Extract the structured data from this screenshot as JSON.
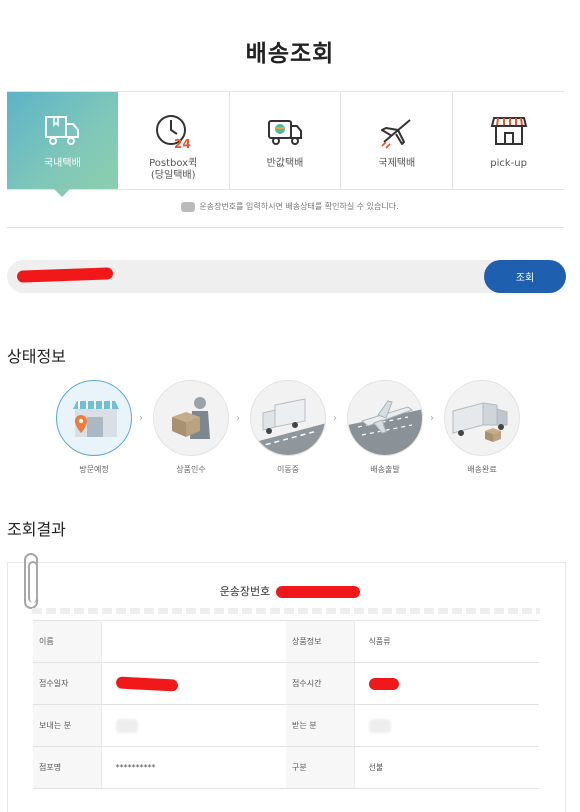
{
  "page_title": "배송조회",
  "tabs": [
    {
      "label": "국내택배",
      "icon": "truck-box-icon",
      "active": true
    },
    {
      "label": "Postbox퀵\n(당일택배)",
      "icon": "clock-24-icon",
      "active": false
    },
    {
      "label": "반값택배",
      "icon": "delivery-van-icon",
      "active": false
    },
    {
      "label": "국제택배",
      "icon": "airplane-icon",
      "active": false
    },
    {
      "label": "pick-up",
      "icon": "store-icon",
      "active": false
    }
  ],
  "notice": "운송장번호를 입력하시면 배송상태를 확인하실 수 있습니다.",
  "search": {
    "placeholder": "",
    "button_label": "조회"
  },
  "status_section_title": "상태정보",
  "steps": [
    {
      "label": "방문예정",
      "icon": "store-location-icon",
      "active": true
    },
    {
      "label": "상품인수",
      "icon": "courier-box-icon",
      "active": false
    },
    {
      "label": "이동중",
      "icon": "truck-road-icon",
      "active": false
    },
    {
      "label": "배송출발",
      "icon": "airport-plane-icon",
      "active": false
    },
    {
      "label": "배송완료",
      "icon": "delivered-truck-icon",
      "active": false
    }
  ],
  "result_section_title": "조회결과",
  "result": {
    "waybill_label": "운송장번호",
    "rows": [
      {
        "k1": "이름",
        "v1": "",
        "k2": "상품정보",
        "v2": "식품류"
      },
      {
        "k1": "접수일자",
        "v1": "",
        "k2": "접수시간",
        "v2": ""
      },
      {
        "k1": "보내는 분",
        "v1": "",
        "k2": "받는 분",
        "v2": ""
      },
      {
        "k1": "점포명",
        "v1": "**********",
        "k2": "구분",
        "v2": "선불"
      }
    ]
  },
  "colors": {
    "accent": "#1f5fb0",
    "tab_active_start": "#5cb3c8",
    "tab_active_end": "#8dceae",
    "redaction": "#f01818"
  }
}
